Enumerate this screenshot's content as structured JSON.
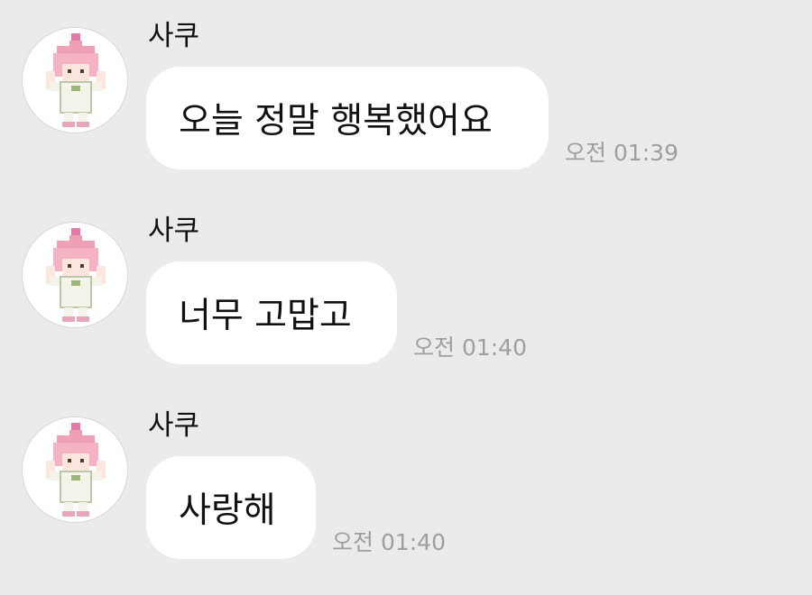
{
  "messages": [
    {
      "sender": "사쿠",
      "avatar_icon": "pixel-character-avatar-icon",
      "text": "오늘 정말 행복했어요",
      "time": "오전 01:39"
    },
    {
      "sender": "사쿠",
      "avatar_icon": "pixel-character-avatar-icon",
      "text": "너무 고맙고",
      "time": "오전 01:40"
    },
    {
      "sender": "사쿠",
      "avatar_icon": "pixel-character-avatar-icon",
      "text": "사랑해",
      "time": "오전 01:40"
    }
  ],
  "colors": {
    "background": "#ebebeb",
    "bubble": "#ffffff",
    "text": "#111111",
    "timestamp": "#9e9e9e",
    "avatar_hair": "#f0a0b4"
  }
}
